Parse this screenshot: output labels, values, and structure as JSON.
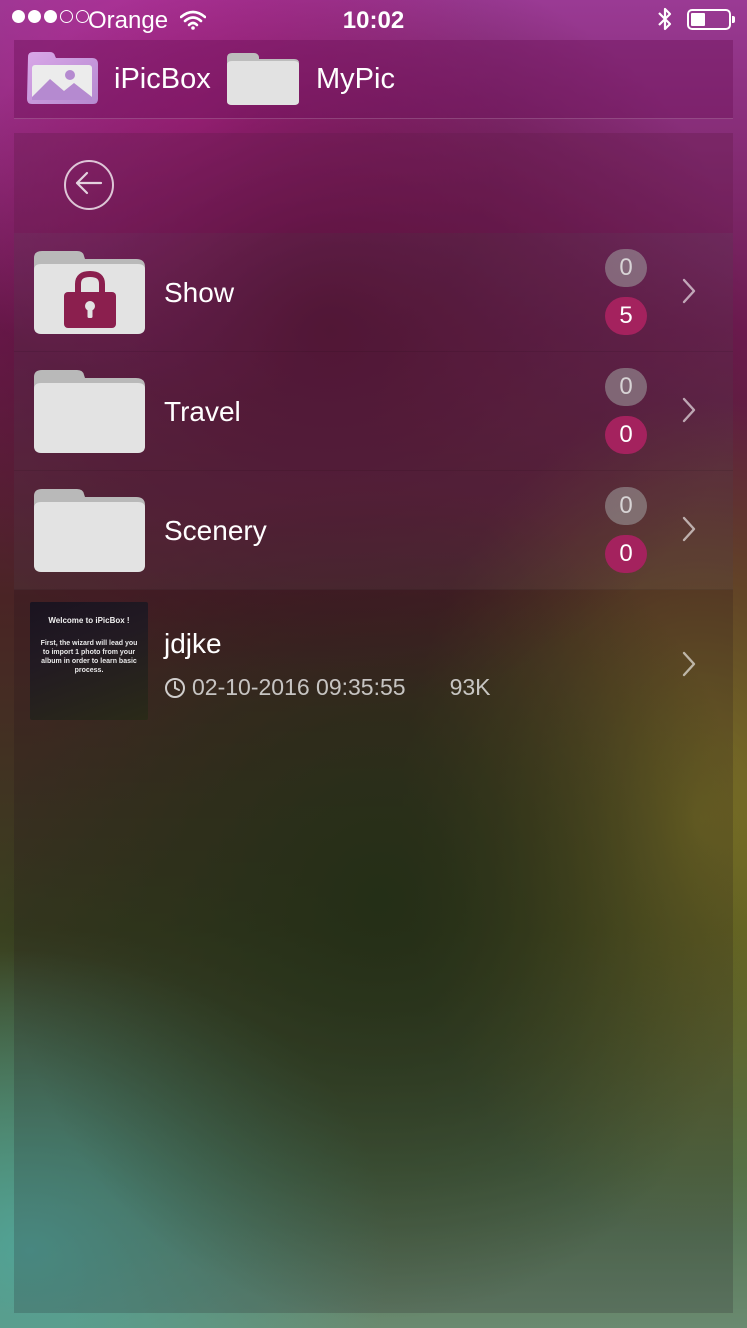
{
  "status_bar": {
    "carrier": "Orange",
    "time": "10:02",
    "signal_bars_filled": 3,
    "signal_bars_total": 5,
    "battery_level": 0.4
  },
  "breadcrumb": {
    "app_name": "iPicBox",
    "current_folder": "MyPic"
  },
  "folders": [
    {
      "name": "Show",
      "locked": true,
      "count_gray": "0",
      "count_pink": "5"
    },
    {
      "name": "Travel",
      "locked": false,
      "count_gray": "0",
      "count_pink": "0"
    },
    {
      "name": "Scenery",
      "locked": false,
      "count_gray": "0",
      "count_pink": "0"
    }
  ],
  "files": [
    {
      "name": "jdjke",
      "timestamp": "02-10-2016 09:35:55",
      "size": "93K",
      "thumbnail": {
        "title": "Welcome to iPicBox !",
        "body": "First, the wizard will lead you to import 1 photo from your album in order to learn basic process."
      }
    }
  ],
  "icons": {
    "back": "back-arrow-icon",
    "chevron": "chevron-right-icon",
    "lock": "lock-icon",
    "clock": "clock-icon"
  },
  "colors": {
    "badge_pink": "#a4225e",
    "badge_gray": "#a0a0a0"
  }
}
